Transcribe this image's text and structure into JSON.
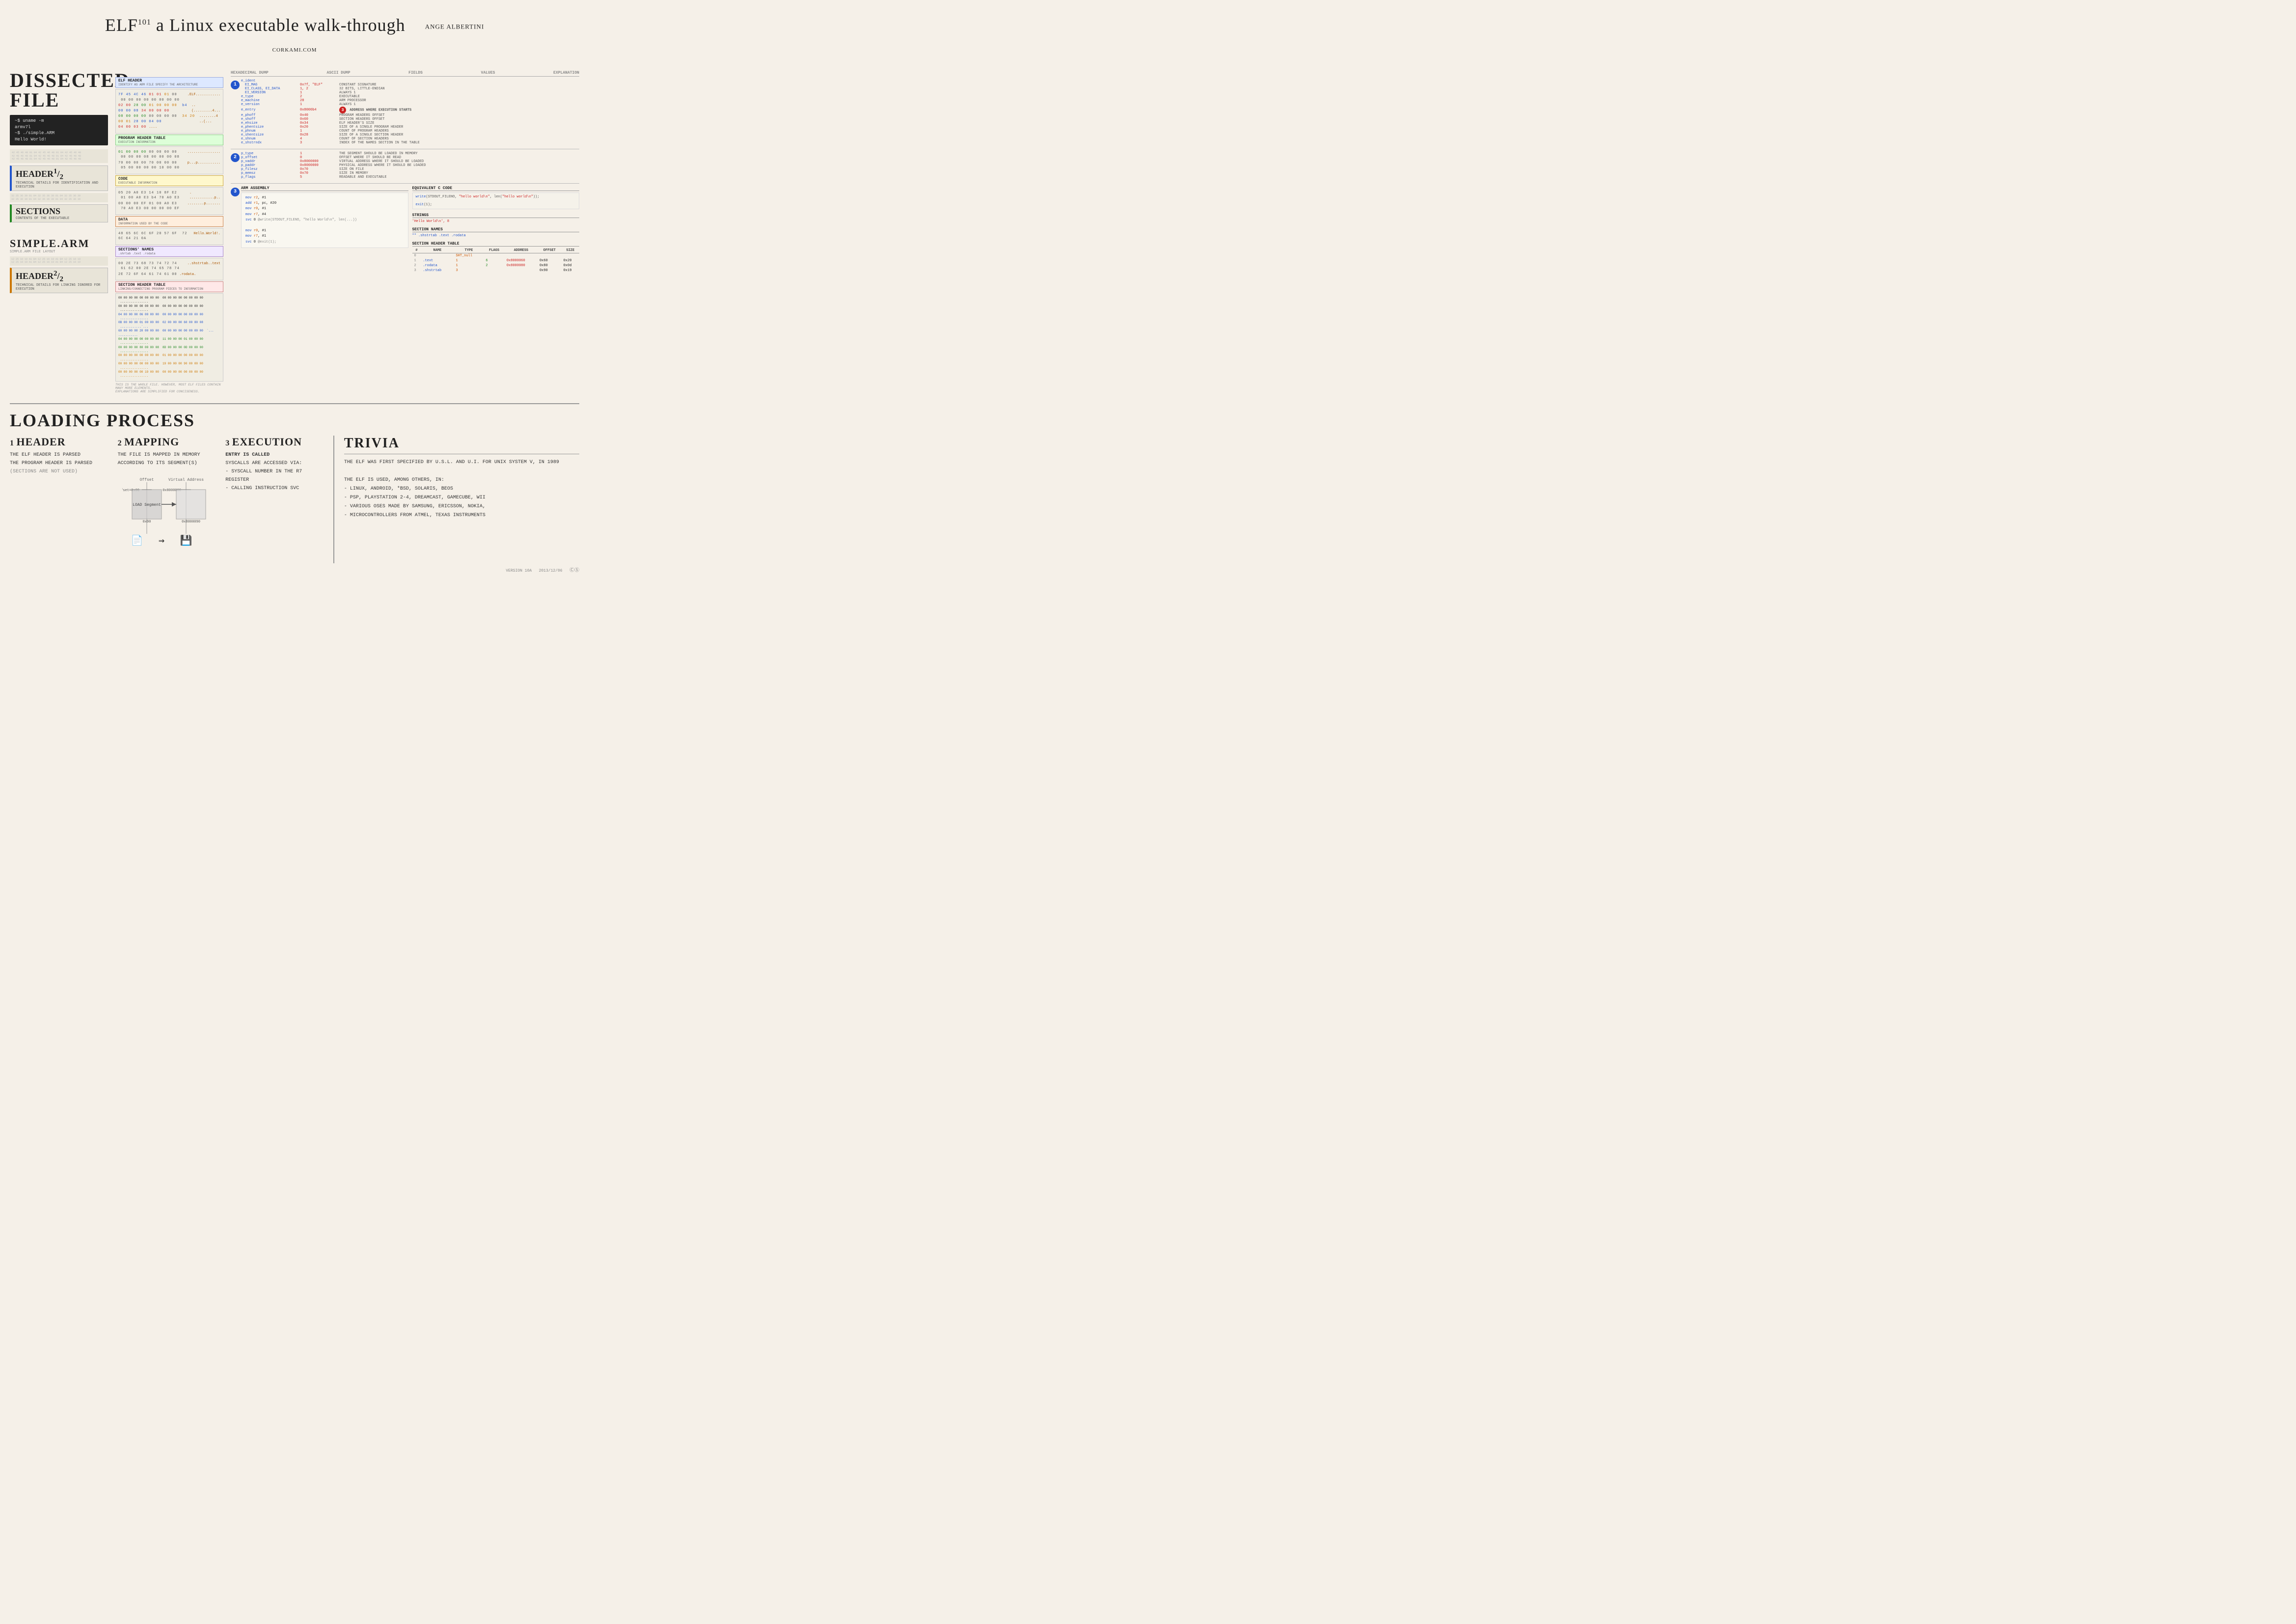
{
  "title": {
    "main": "ELF",
    "sup": "101",
    "rest": " a Linux executable walk-through",
    "author": "ANGE ALBERTINI",
    "site": "CORKAMI.COM"
  },
  "dissected": {
    "title": "DISSECTED FILE",
    "terminal": {
      "lines": [
        "~$ uname -m",
        "armv7l",
        "~$ ./simple.ARM",
        "Hello World!"
      ]
    },
    "sections": {
      "header1": {
        "title": "HEADER¹⁄₂",
        "subtitle": "TECHNICAL DETAILS FOR IDENTIFICATION AND EXECUTION"
      },
      "sections": {
        "title": "SECTIONS",
        "subtitle": "CONTENTS OF THE EXECUTABLE"
      },
      "header2": {
        "title": "HEADER²⁄₂",
        "subtitle": "TECHNICAL DETAILS FOR LINKING IGNORED FOR EXECUTION"
      },
      "simpleArm": {
        "label": "SIMPLE.ARM",
        "sub": "2A LF 1F 6A 4A 8B 69 1A 3A 2C 3D 7E 4F 5E 6A 5D\nSIMPLE.ARM FILE LAYOUT (OFFSET IN FILE SECTIONS)"
      }
    },
    "subSections": {
      "elfHeader": {
        "label": "ELF HEADER",
        "sub": "IDENTIFY AS ARM FILE\nSPECIFY THE ARCHITECTURE"
      },
      "programHeaderTable": {
        "label": "PROGRAM HEADER TABLE",
        "sub": "EXECUTION INFORMATION"
      },
      "code": {
        "label": "CODE",
        "sub": "EXECUTABLE INFORMATION"
      },
      "data": {
        "label": "DATA",
        "sub": "INFORMATION USED BY THE CODE"
      },
      "sectionNames": {
        "label": "SECTIONS' NAMES",
        "sub": ".shrtab .text .rodata"
      },
      "sectionHeaderTable": {
        "label": "SECTION HEADER TABLE",
        "sub": "LINKING/CONNECTING PROGRAM PIECES TO INFORMATION"
      }
    }
  },
  "dumpHeaders": {
    "hex": "HEXADECIMAL DUMP",
    "ascii": "ASCII DUMP",
    "fields": "FIELDS",
    "values": "VALUES",
    "explanation": "EXPLANATION"
  },
  "elfFields": {
    "group1": [
      {
        "name": "e_ident",
        "value": "",
        "explain": ""
      },
      {
        "name": "EI_MAG",
        "value": "0x7f, \"ELF\"",
        "explain": "CONSTANT SIGNATURE"
      },
      {
        "name": "EI_CLASS, EI_DATA",
        "value": "1,2\"\"\"\"\"\"",
        "explain": "32 BITS, LITTLE-ENDIAN"
      },
      {
        "name": "EI_VERSION",
        "value": "1\"\"\"\"\"",
        "explain": "ALWAYS 1"
      },
      {
        "name": "e_type",
        "value": "2\"\"\"\"",
        "explain": "EXECUTABLE"
      },
      {
        "name": "e_machine",
        "value": "28\"\"\"",
        "explain": "ARM PROCESSOR"
      },
      {
        "name": "e_version",
        "value": "1\"\"\"\"",
        "explain": "ALWAYS 1"
      },
      {
        "name": "e_entry",
        "value": "0x8000b4",
        "explain": "ADDRESS WHERE EXECUTION STARTS"
      },
      {
        "name": "e_phoff",
        "value": "0x40",
        "explain": "PROGRAM HEADERS OFFSET"
      },
      {
        "name": "e_shoff",
        "value": "0x60",
        "explain": "SECTION HEADERS OFFSET"
      },
      {
        "name": "e_flags",
        "value": "0x00",
        "explain": ""
      },
      {
        "name": "e_ehsize",
        "value": "0x34",
        "explain": "ELF HEADER'S SIZE"
      },
      {
        "name": "e_phentsize",
        "value": "0x20",
        "explain": "SIZE OF A SINGLE PROGRAM HEADER"
      },
      {
        "name": "e_phnum",
        "value": "1",
        "explain": "COUNT OF PROGRAM HEADERS"
      },
      {
        "name": "e_shentsize",
        "value": "0x28",
        "explain": "SIZE OF A SINGLE SECTION HEADER"
      },
      {
        "name": "e_shnum",
        "value": "4",
        "explain": "COUNT OF SECTION HEADERS"
      },
      {
        "name": "e_shstrndx",
        "value": "3\"\"",
        "explain": "INDEX OF THE NAMES SECTION IN THE TABLE"
      }
    ],
    "group2": [
      {
        "name": "p_type",
        "value": "1\"\"\"\"",
        "explain": "THE SEGMENT SHOULD BE LOADED IN MEMORY"
      },
      {
        "name": "p_offset",
        "value": "0",
        "explain": "OFFSET WHERE IT SHOULD BE READ"
      },
      {
        "name": "p_vaddr",
        "value": "0x8000000",
        "explain": "VIRTUAL ADDRESS WHERE IT SHOULD BE LOADED"
      },
      {
        "name": "p_paddr",
        "value": "0x8000000",
        "explain": "PHYSICAL ADDRESS WHERE IT SHOULD BE LOADED"
      },
      {
        "name": "p_filesz",
        "value": "0x70",
        "explain": "SIZE ON FILE"
      },
      {
        "name": "p_memsz",
        "value": "0x70",
        "explain": "SIZE IN MEMORY"
      },
      {
        "name": "p_flags",
        "value": "5\"\"\"\"\"",
        "explain": "READABLE AND EXECUTABLE"
      }
    ]
  },
  "armAssembly": {
    "title": "ARM ASSEMBLY",
    "lines": [
      "mov r2, #1",
      "add r1, pc, #20",
      "mov r0, #1",
      "mov r7, #4",
      "svc 0         @write(STDOUT_FILENO, \"hello World\\n\", len(\"hello World\\n\"));",
      "",
      "mov r0, #1",
      "mov r7, #1",
      "svc 0         @exit(1);"
    ]
  },
  "equivalentC": {
    "title": "EQUIVALENT C CODE",
    "code": [
      "write(STDOUT_FILENO, \"hello world\\n\", len(\"hello world\\n\"));",
      "",
      "exit(1);"
    ]
  },
  "strings": {
    "title": "STRINGS",
    "values": [
      "'Hello World\\n', 8"
    ]
  },
  "sectionNames": {
    "title": "SECTION NAMES",
    "values": [
      "\"\"  .shrtab  .text  .rodata"
    ]
  },
  "sectionHeaderTable": {
    "title": "SECTION HEADER TABLE",
    "headers": [
      "#",
      "NAME",
      "TYPE",
      "FLAGS",
      "ADDRESS",
      "OFFSET",
      "SIZE"
    ],
    "rows": [
      {
        "idx": "0",
        "name": "",
        "type": "SHT_null",
        "flags": "",
        "address": "",
        "offset": "",
        "size": ""
      },
      {
        "idx": "1",
        "name": ".text",
        "type": "1\"\"\"\"\"\"\"",
        "flags": "6",
        "address": "0x8000060",
        "offset": "0x60",
        "size": "0x20"
      },
      {
        "idx": "2",
        "name": ".rodata",
        "type": "1\"\"\"\"\"\"\"",
        "flags": "2\"\"\"\"\"\"",
        "address": "0x8000080",
        "offset": "0x80",
        "size": "0x0d"
      },
      {
        "idx": "3",
        "name": ".shrtab",
        "type": "3\"\"\"\"\"\"\"",
        "flags": "",
        "address": "",
        "offset": "0x90",
        "size": "0x19"
      }
    ]
  },
  "hexLines": {
    "line1": "7F 45 4C 46 01 01 01 00  00 00 00 00 00 00 00 00",
    "line1ascii": ".ELF............",
    "line2": "02 00 28 00 01 00 00 00  b4 00 00 08 34 00 00 00",
    "line2ascii": "..(.........4...",
    "line3": "08 00 00 00 00 00 00 00  34 20 00 01 28 00 04 00",
    "line3ascii": "........4 ..(....",
    "line4": "04 00 03 00",
    "line4ascii": "....",
    "line5": "01 00 00 00 00 00 00 00  00 00 00 08 00 00 00 08",
    "line5ascii": "................",
    "line6": "70 00 00 00 70 00 00 00  05 00 00 00 00 10 00 00",
    "line6ascii": "p...p...........",
    "line7code": "05 20 A0 E3 14 10 8F E2  01 00 A0 E3 b4 70 A0 E3",
    "line7ascii": ". ......p.....",
    "line8": "00 00 00 EF 01 00 A0 E3  70 A0 E3 00 00 00 EF",
    "line8ascii": "........p......",
    "lineHW": "48 65 6C 6C 6F 20 57 6F  72 6C 64 21 0a",
    "lineHWascii": "Hello.World!.",
    "lineSN": "00 2E 73 68 73 74 72 74  61 62 00 2E 74 65 78 74",
    "lineSNascii": "..shstrtab..text",
    "lineSN2": "2E 72 6F 64 61 74 61 00",
    "lineSN2ascii": ".rodata.",
    "sht1": "00 00 00 00 00 00 00 00  00 00 00 00 00 00 00 00",
    "sht2": "00 00 00 00 00 00 00 00  00 00 00 00 00 00 00 00",
    "sht3": "04 00 00 00 06 00 00 00  00 00 00 00 00 00 00 00",
    "sht4": "0B 00 00 00 01 00 00 00  02 00 00 00 60 00 80 08",
    "sht5": "60 00 00 00 20 00 00 00  00 00 00 00 00 00 00 00",
    "sht6": "04 00 00 00 00 00 00 00  11 00 00 00 01 00 00 00",
    "sht7": "00 00 00 00 80 00 80 08  8D 00 00 00 0D 00 00 00",
    "sht8": "00 00 00 00 00 00 00 00  01 00 00 00 00 00 00 00",
    "sht9": "00 00 00 00 00 00 00 00  19 00 00 00 90 00 00 00",
    "sht10": "00 00 00 00 00 19 00 00  00 00 00 00 00 00 00 00"
  },
  "loading": {
    "title": "LOADING PROCESS",
    "step1": {
      "number": "1",
      "heading": "HEADER",
      "items": [
        "THE ELF HEADER IS PARSED",
        "THE PROGRAM HEADER IS PARSED",
        "(SECTIONS ARE NOT USED)"
      ]
    },
    "step2": {
      "number": "2",
      "heading": "MAPPING",
      "items": [
        "THE FILE IS MAPPED IN MEMORY",
        "ACCORDING TO ITS SEGMENT(S)"
      ]
    },
    "step3": {
      "number": "3",
      "heading": "EXECUTION",
      "items": [
        "ENTRY IS CALLED",
        "SYSCALLS are ACCESSED VIA:",
        "- SYSCALL NUMBER IN THE R7 REGISTER",
        "- CALLING INSTRUCTION SVC"
      ]
    }
  },
  "diagram": {
    "offset_label": "Offset",
    "virtual_address_label": "Virtual Address",
    "p_offset_label": "p_offset=0x00",
    "p_vaddr_label": "0x8000000",
    "load_segment_label": "LOAD Segment",
    "file_size_label": "0x90",
    "mem_size_label": "0x8000090",
    "file_icon": "📄",
    "arrow_icon": "⇒",
    "mem_icon": "💾"
  },
  "trivia": {
    "title": "TRIVIA",
    "items": [
      "THE ELF WAS FIRST SPECIFIED BY U.S.L. AND U.I. FOR UNIX SYSTEM V, IN 1989",
      "THE ELF IS USED, AMONG OTHERS, IN:",
      "- LINUX, ANDROID, *BSD, SOLARIS, BEOS",
      "- PSP, PLAYSTATION 2-4, DREAMCAST, GAMECUBE, WII",
      "- VARIOUS OSES MADE BY SAMSUNG, ERICSSON, NOKIA,",
      "- MICROCONTROLLERS FROM ATMEL, TEXAS INSTRUMENTS"
    ]
  },
  "version": {
    "label": "VERSION 10A",
    "date": "2013/12/06"
  }
}
